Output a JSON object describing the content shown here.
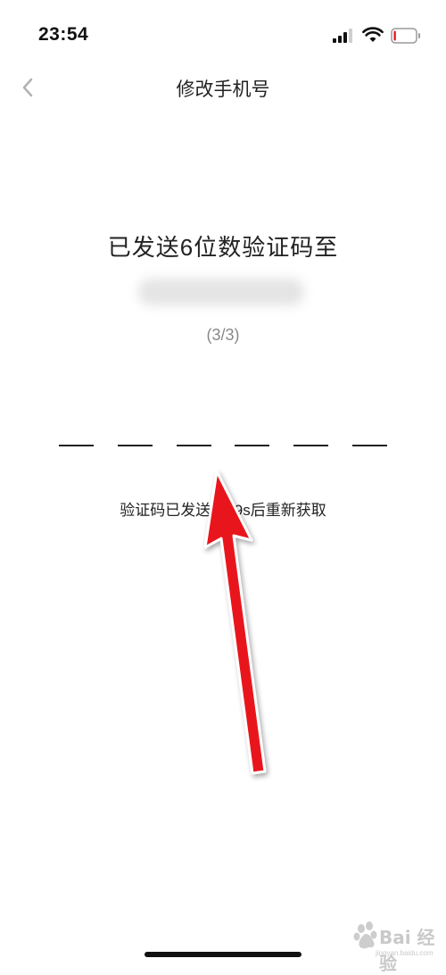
{
  "status_bar": {
    "time": "23:54",
    "battery_level": 0.1
  },
  "nav": {
    "title": "修改手机号",
    "back_icon": "chevron-left-icon"
  },
  "main": {
    "heading": "已发送6位数验证码至",
    "attempt": "(3/3)",
    "code_slots": 6,
    "resend": "验证码已发送，59s后重新获取"
  },
  "annotation_color": "#e8131c",
  "watermark": {
    "brand": "Bai 经验",
    "url": "jingyan.baidu.com"
  }
}
